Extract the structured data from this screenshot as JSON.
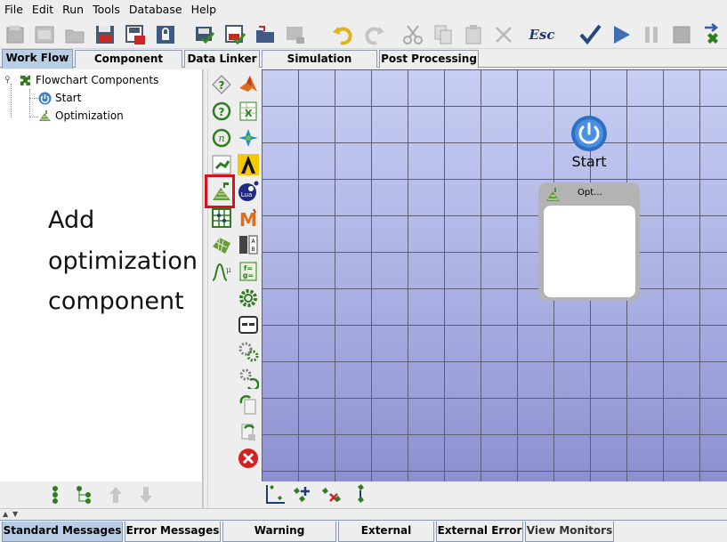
{
  "menu": [
    "File",
    "Edit",
    "Run",
    "Tools",
    "Database",
    "Help"
  ],
  "toolbar": {
    "esc_label": "Esc",
    "icons": [
      "new-icon",
      "open-icon",
      "folder-icon",
      "save-icon",
      "save-as-icon",
      "lock-icon",
      "check-file-icon",
      "check-save-icon",
      "open-folder-icon",
      "monitor-icon",
      "undo-icon",
      "redo-icon",
      "cut-icon",
      "copy-icon",
      "paste-icon",
      "delete-icon",
      "esc-icon",
      "checkmark-icon",
      "play-icon",
      "pause-icon",
      "stop-icon",
      "export-icon"
    ]
  },
  "tabs": [
    "Work Flow",
    "Component Editor",
    "Data Linker",
    "Simulation Monitors",
    "Post Processing"
  ],
  "tree": {
    "root": "Flowchart Components",
    "children": [
      "Start",
      "Optimization"
    ]
  },
  "annotation": {
    "line1": "Add",
    "line2": "optimization",
    "line3": "component"
  },
  "canvas": {
    "start_label": "Start",
    "opt_title": "Opt..."
  },
  "bottom_tabs": [
    "Standard Messages",
    "Error Messages",
    "Warning Messages",
    "External Output",
    "External Error",
    "View Monitors"
  ],
  "colors": {
    "highlight": "#d6131b",
    "active_tab": "#b9cde5",
    "canvas_top": "#c7cef3",
    "canvas_bottom": "#8c90d0",
    "icon_green": "#2e7d1e",
    "start_blue": "#3c7fd0"
  }
}
